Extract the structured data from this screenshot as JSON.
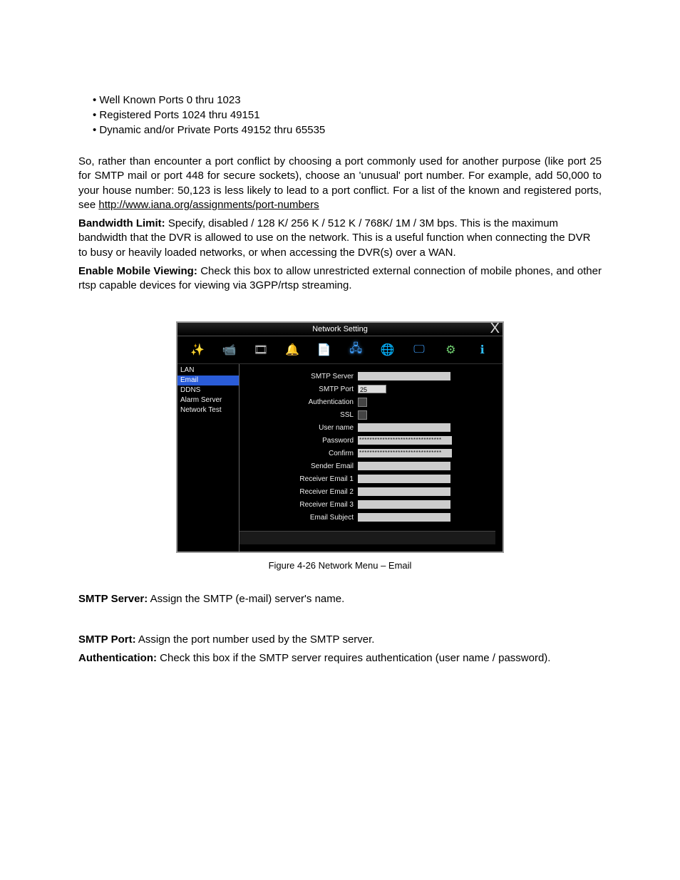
{
  "bullets": {
    "b1": "Well Known Ports 0 thru 1023",
    "b2": "Registered Ports 1024 thru 49151",
    "b3": "Dynamic and/or Private Ports 49152 thru 65535"
  },
  "para1_a": "So, rather than encounter a port conflict by choosing a port commonly used for another purpose (like port 25 for SMTP mail or port 448 for secure sockets), choose an 'unusual' port number. For example, add 50,000 to your house number: 50,123 is less likely to lead to a port conflict. For a list of the known and registered ports, see ",
  "para1_link": "http://www.iana.org/assignments/port-numbers",
  "bw_label": "Bandwidth Limit:",
  "bw_text": " Specify, disabled / 128 K/ 256 K / 512 K / 768K/ 1M / 3M bps. This is the maximum bandwidth that the DVR is allowed to use on the network. This is a useful function when connecting the DVR to busy or heavily loaded networks, or when accessing the DVR(s) over a WAN.",
  "mv_label": "Enable Mobile Viewing:",
  "mv_text": " Check this box to allow unrestricted external connection of mobile phones, and other rtsp capable devices for viewing via 3GPP/rtsp streaming.",
  "dvr": {
    "title": "Network Setting",
    "close": "X",
    "sidebar": {
      "s1": "LAN",
      "s2": "Email",
      "s3": "DDNS",
      "s4": "Alarm Server",
      "s5": "Network Test"
    },
    "form": {
      "smtp_server": "SMTP Server",
      "smtp_port": "SMTP Port",
      "smtp_port_value": "25",
      "auth": "Authentication",
      "ssl": "SSL",
      "user": "User name",
      "password": "Password",
      "password_value": "********************************",
      "confirm": "Confirm",
      "confirm_value": "********************************",
      "sender": "Sender Email",
      "recv1": "Receiver Email 1",
      "recv2": "Receiver Email 2",
      "recv3": "Receiver Email 3",
      "subject": "Email Subject"
    }
  },
  "caption": "Figure 4-26  Network Menu – Email",
  "smtp_server_label": "SMTP Server:",
  "smtp_server_text": " Assign the SMTP (e-mail) server's name.",
  "smtp_port_label": "SMTP Port:",
  "smtp_port_text": " Assign the port number used by the SMTP server.",
  "auth_label": "Authentication:",
  "auth_text": " Check this box if the SMTP server requires authentication (user name / password)."
}
